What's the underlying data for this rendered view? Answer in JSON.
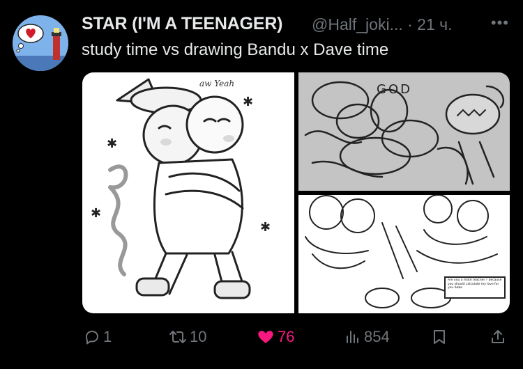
{
  "tweet": {
    "author_name": "STAR (I'M A TEENAGER)",
    "handle": "@Half_joki...",
    "time": "· 21 ч.",
    "more": "•••",
    "text": "study time vs drawing Bandu x Dave time"
  },
  "media": {
    "left_caption": "aw Yeah",
    "top_right_caption": "GOD",
    "bottom_right_speech": "Are you a math teacher ? because you should calculate my love for you babe"
  },
  "actions": {
    "replies": "1",
    "reposts": "10",
    "likes": "76",
    "views": "854"
  },
  "colors": {
    "background": "#000000",
    "text": "#e7e9ea",
    "secondary": "#71767b",
    "like": "#f91880"
  },
  "icons": [
    "reply-icon",
    "repost-icon",
    "heart-icon",
    "views-icon",
    "bookmark-icon",
    "share-icon",
    "more-icon"
  ]
}
